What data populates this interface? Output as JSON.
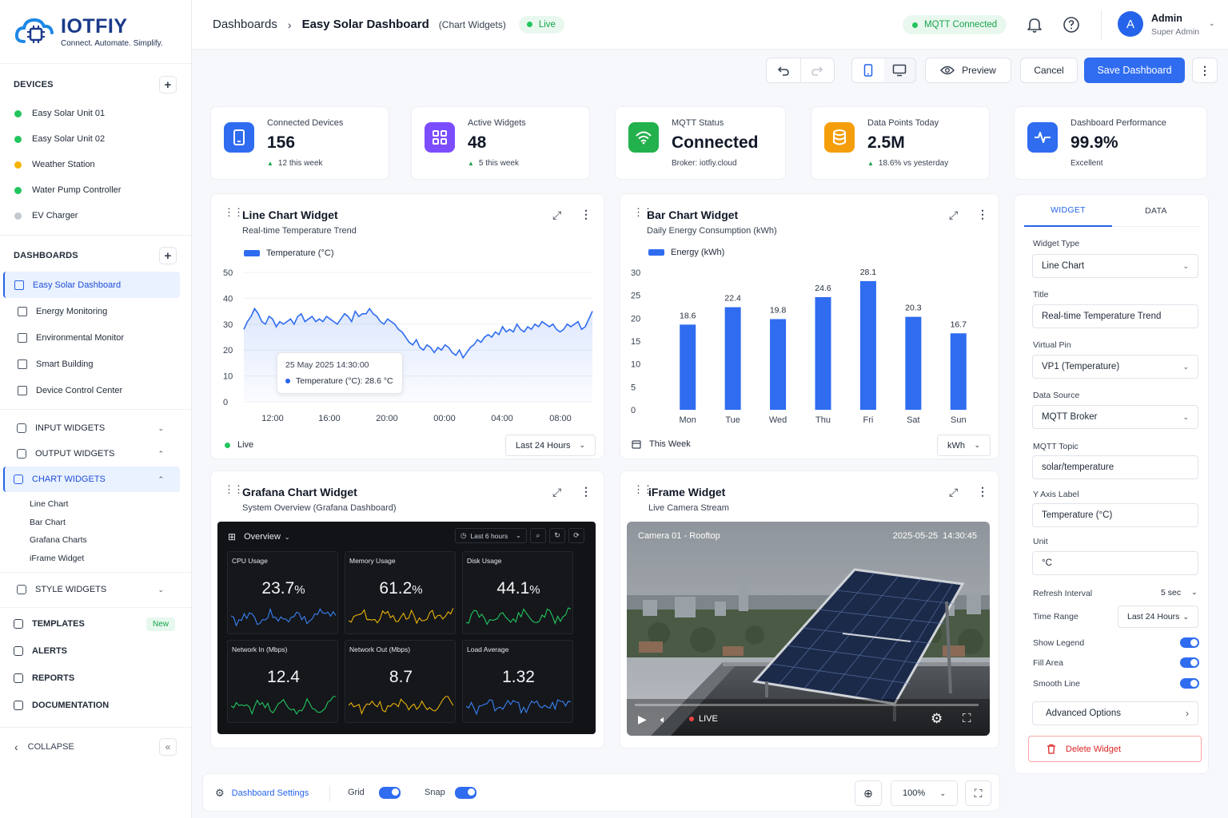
{
  "brand": {
    "name": "IOTFIY",
    "tagline": "Connect. Automate. Simplify."
  },
  "sidebar": {
    "devices_title": "DEVICES",
    "devices": [
      {
        "label": "Easy Solar Unit 01",
        "color": "#22c55e"
      },
      {
        "label": "Easy Solar Unit 02",
        "color": "#22c55e"
      },
      {
        "label": "Weather Station",
        "color": "#f5b400"
      },
      {
        "label": "Water Pump Controller",
        "color": "#22c55e"
      },
      {
        "label": "EV Charger",
        "color": "#c4c8cf"
      }
    ],
    "dashboards_title": "DASHBOARDS",
    "dashboards": [
      "Easy Solar Dashboard",
      "Energy Monitoring",
      "Environmental Monitor",
      "Smart Building",
      "Device Control Center"
    ],
    "groups": [
      {
        "label": "INPUT WIDGETS",
        "chev": "⌄"
      },
      {
        "label": "OUTPUT WIDGETS",
        "chev": "⌃"
      },
      {
        "label": "CHART WIDGETS",
        "chev": "⌃"
      }
    ],
    "chart_items": [
      "Line Chart",
      "Bar Chart",
      "Grafana Charts",
      "iFrame Widget"
    ],
    "style_widgets": "STYLE WIDGETS",
    "lower": [
      {
        "label": "TEMPLATES",
        "badge": "New"
      },
      {
        "label": "ALERTS"
      },
      {
        "label": "REPORTS"
      },
      {
        "label": "DOCUMENTATION"
      }
    ],
    "collapse": "COLLAPSE"
  },
  "header": {
    "crumb1": "Dashboards",
    "crumb2": "Easy Solar Dashboard",
    "crumb3": "(Chart Widgets)",
    "live": "Live",
    "mqtt": "MQTT Connected",
    "user_name": "Admin",
    "user_role": "Super Admin",
    "avatar": "A"
  },
  "toolbar": {
    "preview": "Preview",
    "cancel": "Cancel",
    "save": "Save Dashboard"
  },
  "stats": [
    {
      "label": "Connected Devices",
      "value": "156",
      "sub": "12 this week",
      "trend": true,
      "color": "#2f6cf0"
    },
    {
      "label": "Active Widgets",
      "value": "48",
      "sub": "5 this week",
      "trend": true,
      "color": "#7c4dff"
    },
    {
      "label": "MQTT Status",
      "value": "Connected",
      "sub": "Broker: iotfiy.cloud",
      "trend": false,
      "color": "#22b14c"
    },
    {
      "label": "Data Points Today",
      "value": "2.5M",
      "sub": "18.6% vs yesterday",
      "trend": true,
      "color": "#f59e0b"
    },
    {
      "label": "Dashboard Performance",
      "value": "99.9%",
      "sub": "Excellent",
      "trend": false,
      "color": "#2f6cf0"
    }
  ],
  "line_widget": {
    "title": "Line Chart Widget",
    "subtitle": "Real-time Temperature Trend",
    "legend": "Temperature (°C)",
    "tooltip_time": "25 May 2025 14:30:00",
    "tooltip_value": "Temperature (°C): 28.6 °C",
    "live": "Live",
    "range": "Last 24 Hours"
  },
  "bar_widget": {
    "title": "Bar Chart Widget",
    "subtitle": "Daily Energy Consumption (kWh)",
    "legend": "Energy (kWh)",
    "period": "This Week",
    "unit": "kWh"
  },
  "grafana_widget": {
    "title": "Grafana Chart Widget",
    "subtitle": "System Overview (Grafana Dashboard)",
    "overview": "Overview",
    "range": "Last 6 hours",
    "panels": [
      {
        "label": "CPU Usage",
        "value": "23.7",
        "unit": "%",
        "color": "#3b82f6"
      },
      {
        "label": "Memory Usage",
        "value": "61.2",
        "unit": "%",
        "color": "#eab308"
      },
      {
        "label": "Disk Usage",
        "value": "44.1",
        "unit": "%",
        "color": "#22c55e"
      },
      {
        "label": "Network In (Mbps)",
        "value": "12.4",
        "unit": "",
        "color": "#22c55e"
      },
      {
        "label": "Network Out (Mbps)",
        "value": "8.7",
        "unit": "",
        "color": "#eab308"
      },
      {
        "label": "Load Average",
        "value": "1.32",
        "unit": "",
        "color": "#3b82f6"
      }
    ]
  },
  "iframe_widget": {
    "title": "iFrame Widget",
    "subtitle": "Live Camera Stream",
    "camera": "Camera 01 - Rooftop",
    "timestamp": "2025-05-25  14:30:45",
    "live": "LIVE"
  },
  "panel": {
    "tab_widget": "WIDGET",
    "tab_data": "DATA",
    "widget_type_label": "Widget Type",
    "widget_type": "Line Chart",
    "title_label": "Title",
    "title": "Real-time Temperature Trend",
    "vpin_label": "Virtual Pin",
    "vpin": "VP1 (Temperature)",
    "source_label": "Data Source",
    "source": "MQTT Broker",
    "topic_label": "MQTT Topic",
    "topic": "solar/temperature",
    "yaxis_label": "Y Axis Label",
    "yaxis": "Temperature (°C)",
    "unit_label": "Unit",
    "unit": "°C",
    "refresh_label": "Refresh Interval",
    "refresh": "5 sec",
    "range_label": "Time Range",
    "range": "Last 24 Hours",
    "show_legend": "Show Legend",
    "fill_area": "Fill Area",
    "smooth_line": "Smooth Line",
    "advanced": "Advanced Options",
    "delete": "Delete Widget"
  },
  "bottom": {
    "settings": "Dashboard Settings",
    "grid": "Grid",
    "snap": "Snap",
    "zoom": "100%"
  },
  "chart_data": [
    {
      "type": "line",
      "title": "",
      "series": [
        {
          "name": "Temperature (°C)"
        }
      ],
      "x": [
        "12:00",
        "",
        "",
        "",
        "",
        "",
        "",
        "",
        "",
        "",
        "",
        "",
        "",
        "",
        "",
        "",
        "",
        "16:00",
        "",
        "",
        "",
        "",
        "",
        "",
        "",
        "",
        "",
        "",
        "",
        "",
        "",
        "",
        "",
        "20:00",
        "",
        "",
        "",
        "",
        "",
        "",
        "",
        "",
        "",
        "",
        "",
        "",
        "",
        "",
        "",
        "00:00",
        "",
        "",
        "",
        "",
        "",
        "",
        "",
        "",
        "",
        "",
        "",
        "",
        "",
        "",
        "",
        "04:00",
        "",
        "",
        "",
        "",
        "",
        "",
        "",
        "",
        "",
        "",
        "",
        "",
        "",
        "",
        "",
        "08:00",
        "",
        "",
        "",
        "",
        "",
        "",
        "",
        "",
        "",
        "",
        ""
      ],
      "xticks": [
        "12:00",
        "16:00",
        "20:00",
        "00:00",
        "04:00",
        "08:00"
      ],
      "values": [
        28,
        31,
        33,
        36,
        34,
        31,
        30,
        33,
        32,
        29,
        31,
        30,
        31,
        32,
        30,
        33,
        34,
        31,
        32,
        33,
        31,
        32,
        31,
        33,
        32,
        31,
        30,
        32,
        34,
        33,
        31,
        35,
        33,
        34,
        34,
        36,
        34,
        33,
        31,
        30,
        32,
        31,
        30,
        28,
        27,
        25,
        23,
        22,
        24,
        21,
        20,
        22,
        21,
        19,
        21,
        20,
        22,
        21,
        19,
        18,
        20,
        17,
        19,
        21,
        22,
        24,
        23,
        25,
        26,
        25,
        27,
        26,
        29,
        27,
        28,
        27,
        30,
        28,
        27,
        29,
        28,
        30,
        29,
        31,
        30,
        29,
        30,
        28,
        27,
        28,
        30,
        29,
        30,
        31,
        28,
        29,
        32,
        35
      ],
      "yticks": [
        0,
        10,
        20,
        30,
        40,
        50
      ],
      "ylim": [
        0,
        50
      ]
    },
    {
      "type": "bar",
      "title": "",
      "categories": [
        "Mon",
        "Tue",
        "Wed",
        "Thu",
        "Fri",
        "Sat",
        "Sun"
      ],
      "series": [
        {
          "name": "Energy (kWh)",
          "values": [
            18.6,
            22.4,
            19.8,
            24.6,
            28.1,
            20.3,
            16.7
          ]
        }
      ],
      "yticks": [
        0,
        5,
        10,
        15,
        20,
        25,
        30
      ],
      "ylim": [
        0,
        30
      ]
    }
  ]
}
